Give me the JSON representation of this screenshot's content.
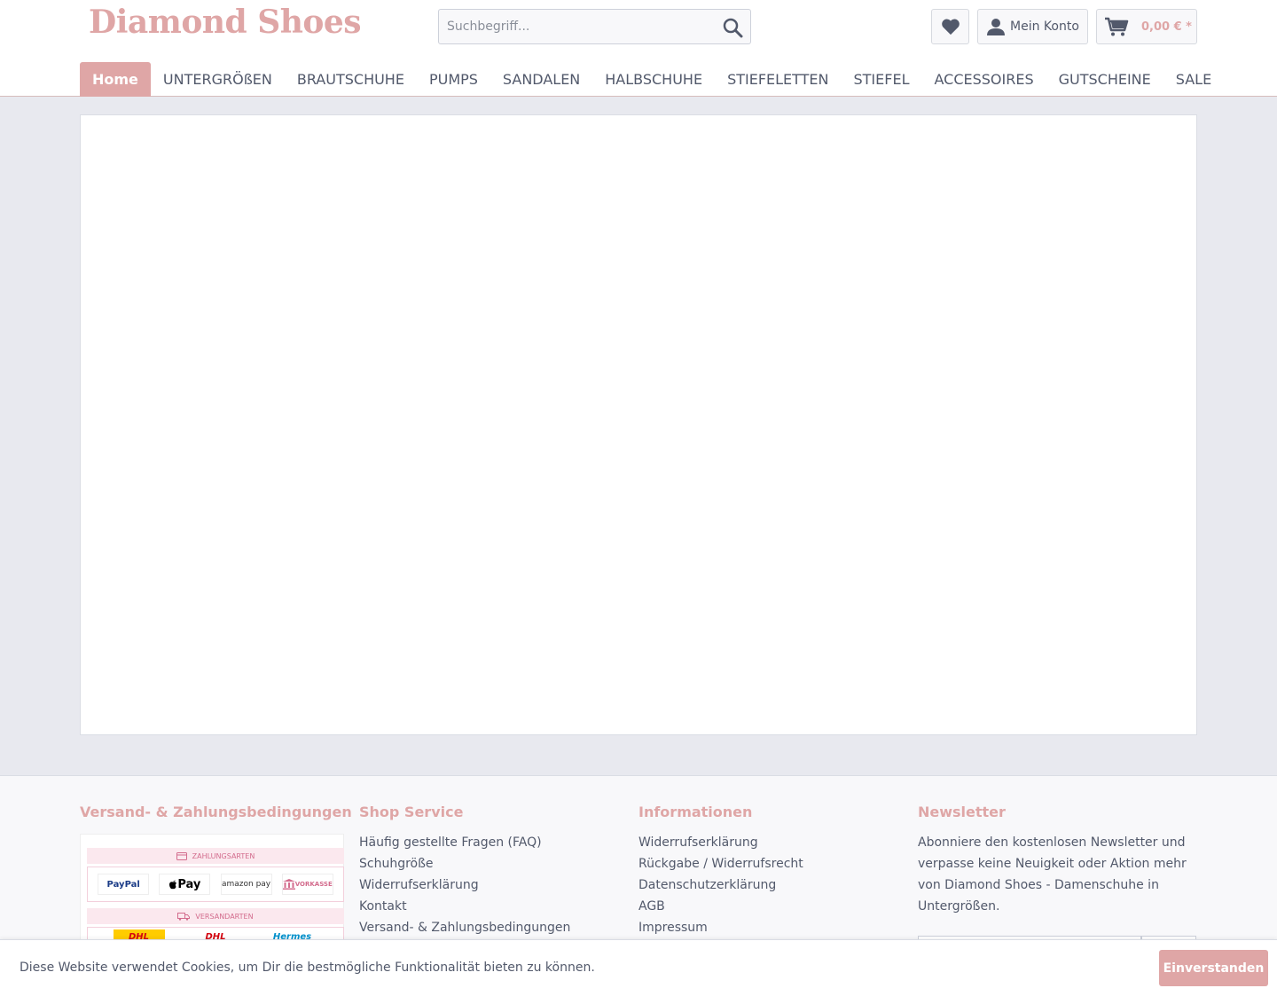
{
  "header": {
    "logo_text": "Diamond Shoes",
    "search_placeholder": "Suchbegriff...",
    "account_label": "Mein Konto",
    "cart_label": "0,00 € *",
    "brand_color": "#dfa6a6"
  },
  "nav": {
    "items": [
      "Home",
      "UNTERGRÖßEN",
      "BRAUTSCHUHE",
      "PUMPS",
      "SANDALEN",
      "HALBSCHUHE",
      "STIEFELETTEN",
      "STIEFEL",
      "ACCESSOIRES",
      "GUTSCHEINE",
      "SALE"
    ],
    "active_index": 0
  },
  "footer": {
    "col1": {
      "title": "Versand- & Zahlungsbedingungen",
      "payment_heading": "ZAHLUNGSARTEN",
      "payment_methods": [
        "PayPal",
        "Pay",
        "amazon pay",
        "VORKASSE"
      ],
      "shipping_heading": "VERSANDARTEN",
      "shipping_methods": [
        "DHL",
        "DHL",
        "Hermes"
      ]
    },
    "col2": {
      "title": "Shop Service",
      "links": [
        "Häufig gestellte Fragen (FAQ)",
        "Schuhgröße",
        "Widerrufserklärung",
        "Kontakt",
        "Versand- & Zahlungsbedingungen"
      ]
    },
    "col3": {
      "title": "Informationen",
      "links": [
        "Widerrufserklärung",
        "Rückgabe / Widerrufsrecht",
        "Datenschutzerklärung",
        "AGB",
        "Impressum"
      ]
    },
    "col4": {
      "title": "Newsletter",
      "text": "Abonniere den kostenlosen Newsletter und verpasse keine Neuigkeit oder Aktion mehr von Diamond Shoes - Damenschuhe in Untergrößen."
    }
  },
  "cookie": {
    "text": "Diese Website verwendet Cookies, um Dir die bestmögliche Funktionalität bieten zu können.",
    "button": "Einverstanden"
  }
}
